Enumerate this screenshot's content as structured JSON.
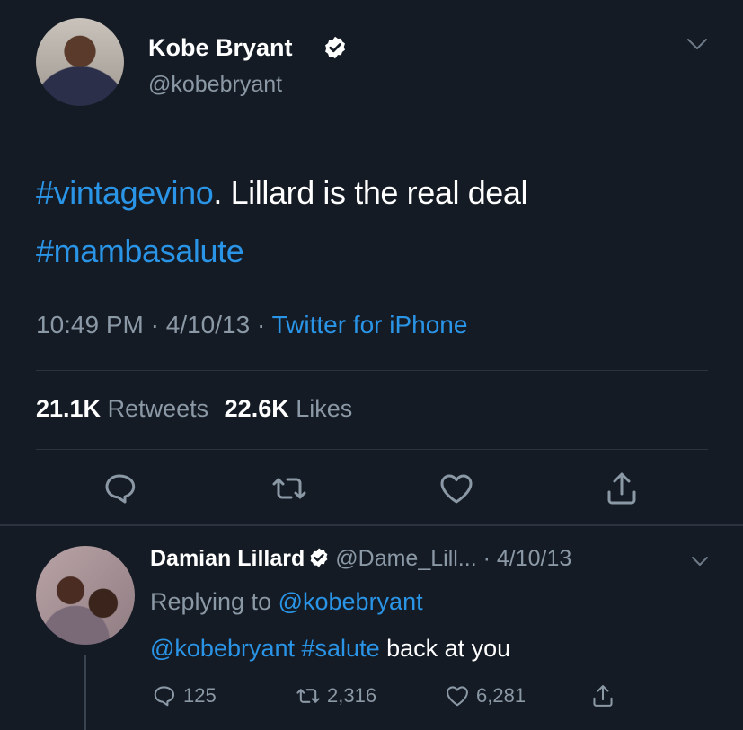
{
  "tweet": {
    "author_name": "Kobe Bryant",
    "author_handle": "@kobebryant",
    "hashtag1": "#vintagevino",
    "text_middle": ". Lillard is the real deal",
    "hashtag2": "#mambasalute",
    "time": "10:49 PM",
    "sep1": " · ",
    "date": "4/10/13",
    "sep2": " · ",
    "source": "Twitter for iPhone",
    "retweets_count": "21.1K",
    "retweets_label": "Retweets",
    "likes_count": "22.6K",
    "likes_label": "Likes",
    "icons": {
      "verified": "verified-badge-icon",
      "menu": "chevron-down-icon",
      "reply": "reply-bubble-icon",
      "retweet": "retweet-icon",
      "like": "heart-icon",
      "share": "share-icon"
    }
  },
  "reply": {
    "author_name": "Damian Lillard",
    "author_handle": "@Dame_Lill...",
    "sep": " · ",
    "date": "4/10/13",
    "replying_prefix": "Replying to ",
    "replying_to": "@kobebryant",
    "mention": "@kobebryant",
    "hashtag": "#salute",
    "text_rest": " back at you",
    "reply_count": "125",
    "retweet_count": "2,316",
    "like_count": "6,281"
  },
  "colors": {
    "background": "#141b25",
    "link": "#2a94e6",
    "muted": "#8b98a5",
    "divider": "#2a333e"
  }
}
